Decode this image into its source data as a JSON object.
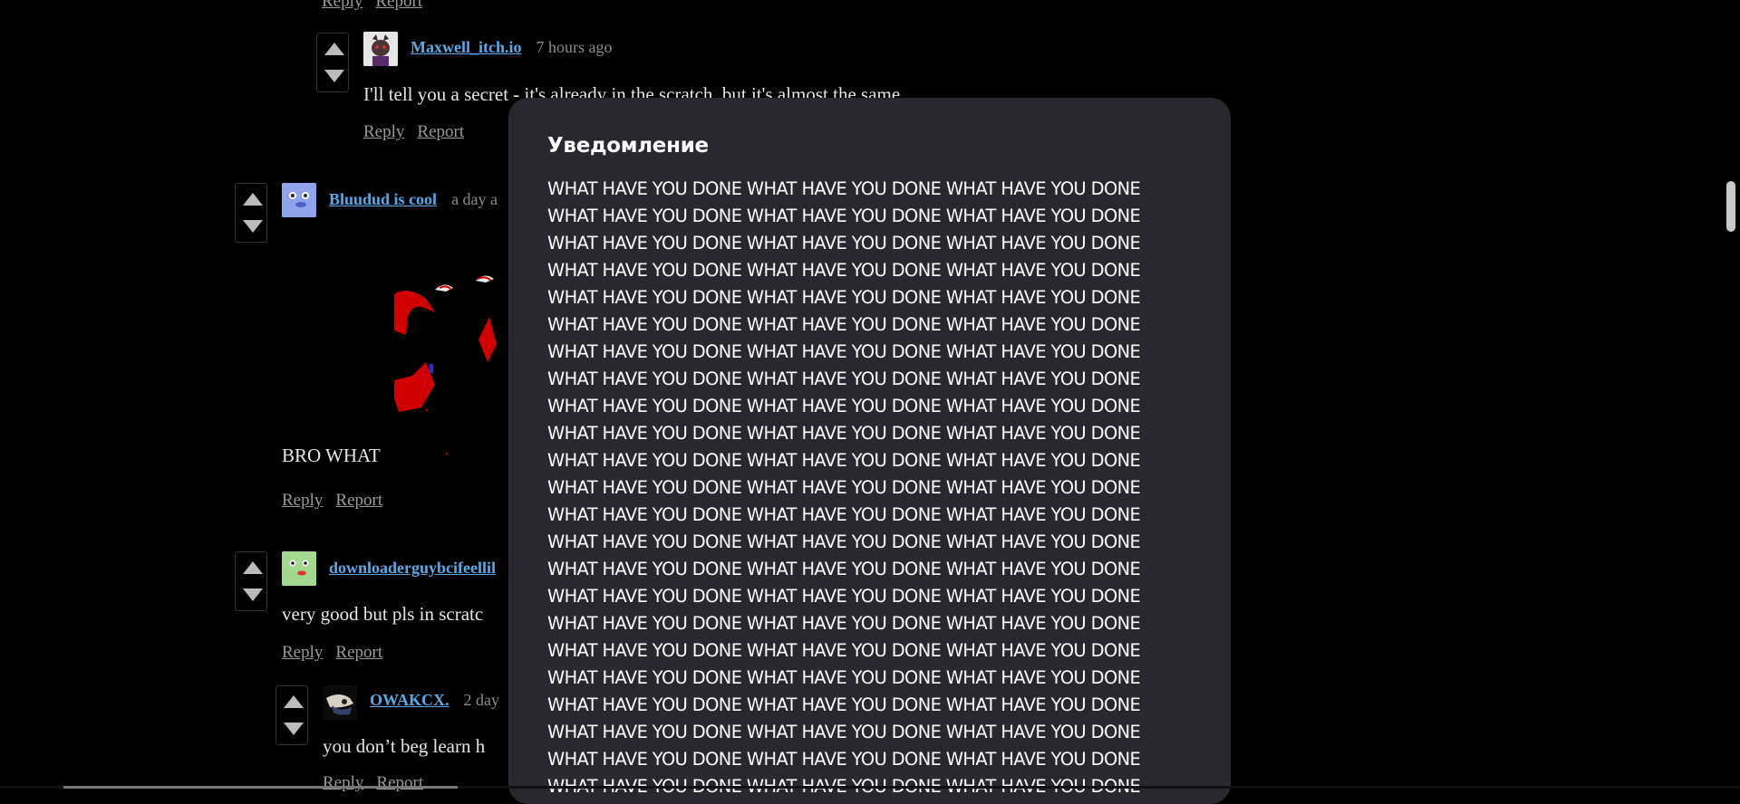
{
  "top_actions": {
    "reply": "Reply",
    "report": "Report"
  },
  "comments": [
    {
      "username": "Maxwell_itch.io",
      "time": "7 hours ago",
      "text": "I'll tell you a secret - it's already in the scratch, but it's almost the same",
      "reply": "Reply",
      "report": "Report"
    },
    {
      "username": "Bluudud is cool",
      "time": "a day a",
      "text": "BRO WHAT",
      "reply": "Reply",
      "report": "Report"
    },
    {
      "username": "downloaderguybcifeellil",
      "text": "very good but pls in scratc",
      "reply": "Reply",
      "report": "Report"
    },
    {
      "username": "OWAKCX.",
      "time": "2 day",
      "text": "you don’t beg learn h",
      "reply": "Reply",
      "report": "Report"
    }
  ],
  "modal": {
    "title": "Уведомление",
    "line": "WHAT HAVE YOU DONE WHAT HAVE YOU DONE WHAT HAVE YOU DONE",
    "line_count": 23
  },
  "colors": {
    "background": "#000000",
    "modal_bg": "#28282e",
    "username": "#5aa9e6",
    "link": "#999999"
  }
}
